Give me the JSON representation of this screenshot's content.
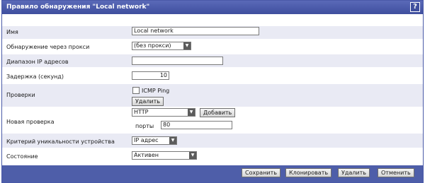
{
  "header": {
    "title": "Правило обнаружения \"Local network\"",
    "help_label": "?"
  },
  "form": {
    "name": {
      "label": "Имя",
      "value": "Local network"
    },
    "proxy": {
      "label": "Обнаружение через прокси",
      "value": "(без прокси)"
    },
    "ip_range": {
      "label": "Диапазон IP адресов",
      "value": ""
    },
    "delay": {
      "label": "Задержка (секунд)",
      "value": "10"
    },
    "checks": {
      "label": "Проверки",
      "item": "ICMP Ping",
      "delete_label": "Удалить"
    },
    "new_check": {
      "label": "Новая проверка",
      "type": "HTTP",
      "add_label": "Добавить",
      "ports_label": "порты",
      "ports_value": "80"
    },
    "uniqueness": {
      "label": "Критерий уникальности устройства",
      "value": "IP адрес"
    },
    "state": {
      "label": "Состояние",
      "value": "Активен"
    }
  },
  "footer": {
    "save_label": "Сохранить",
    "clone_label": "Клонировать",
    "delete_label": "Удалить",
    "cancel_label": "Отменить"
  },
  "icons": {
    "dropdown": "chevron-down-icon",
    "help": "help-icon",
    "checkbox": "checkbox-unchecked"
  },
  "colors": {
    "titlebar": "#4a5aa8",
    "band": "#e9eaf4",
    "footer": "#4e5ea9"
  }
}
